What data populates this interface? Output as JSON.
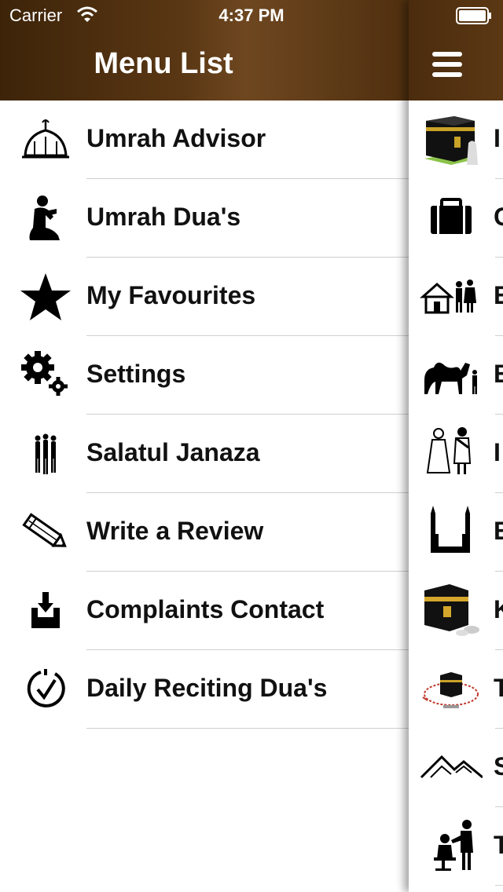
{
  "status_bar": {
    "carrier": "Carrier",
    "time": "4:37 PM"
  },
  "menu": {
    "title": "Menu List",
    "items": [
      {
        "label": "Umrah Advisor",
        "icon": "mosque-dome-icon"
      },
      {
        "label": "Umrah Dua's",
        "icon": "praying-person-icon"
      },
      {
        "label": "My Favourites",
        "icon": "star-icon"
      },
      {
        "label": "Settings",
        "icon": "gears-icon"
      },
      {
        "label": "Salatul Janaza",
        "icon": "standing-people-icon"
      },
      {
        "label": "Write a Review",
        "icon": "pencil-icon"
      },
      {
        "label": "Complaints Contact",
        "icon": "inbox-download-icon"
      },
      {
        "label": "Daily Reciting Dua's",
        "icon": "checkmark-clock-icon"
      }
    ]
  },
  "main_list": {
    "items": [
      {
        "label": "I",
        "icon": "kaaba-icon"
      },
      {
        "label": "C",
        "icon": "briefcase-icon"
      },
      {
        "label": "E",
        "icon": "house-family-icon"
      },
      {
        "label": "E",
        "icon": "camel-icon"
      },
      {
        "label": "I",
        "icon": "ihram-couple-icon"
      },
      {
        "label": "E",
        "icon": "minarets-icon"
      },
      {
        "label": "K",
        "icon": "kaaba-cloth-icon"
      },
      {
        "label": "T",
        "icon": "tawaf-diagram-icon"
      },
      {
        "label": "S",
        "icon": "mountains-icon"
      },
      {
        "label": "T",
        "icon": "haircut-icon"
      }
    ]
  },
  "colors": {
    "header_brown": "#5a3714",
    "separator": "#cfcfcf"
  }
}
